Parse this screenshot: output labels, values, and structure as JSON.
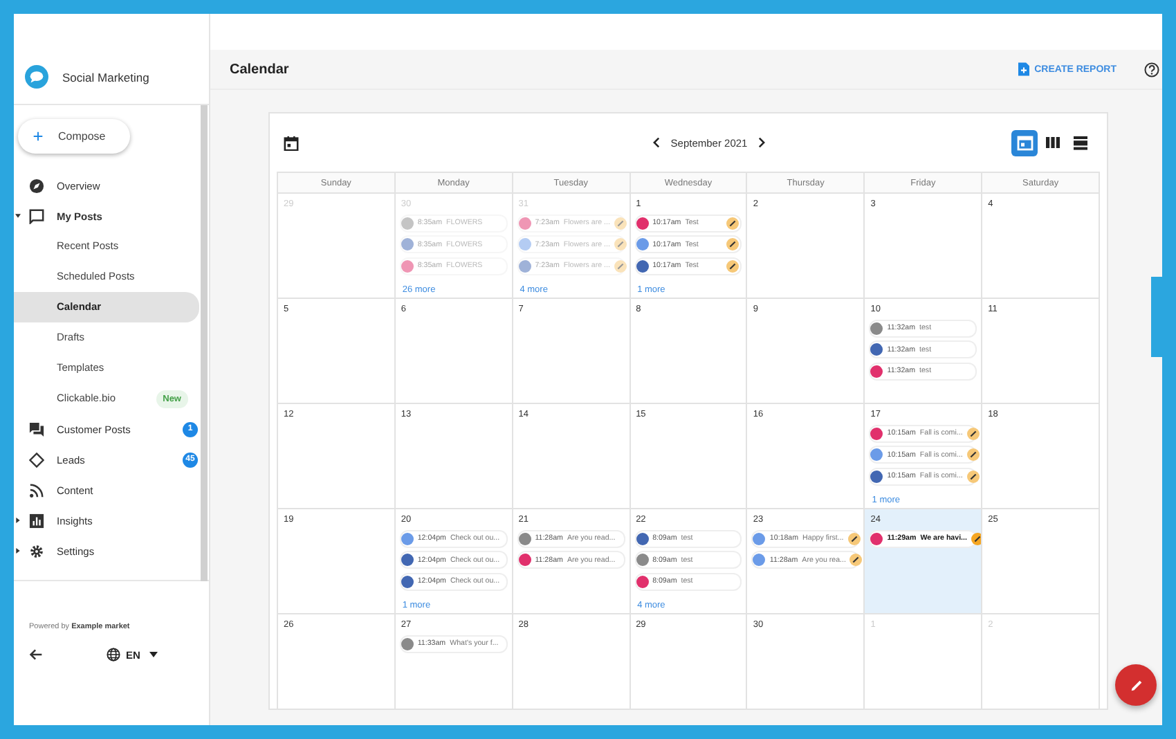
{
  "app": {
    "name": "Social Marketing"
  },
  "compose": {
    "label": "Compose"
  },
  "sidebar": {
    "items": [
      {
        "label": "Overview"
      },
      {
        "label": "My Posts",
        "expanded": true,
        "children": [
          {
            "label": "Recent Posts",
            "selected": false
          },
          {
            "label": "Scheduled Posts",
            "selected": false
          },
          {
            "label": "Calendar",
            "selected": true
          },
          {
            "label": "Drafts",
            "selected": false
          },
          {
            "label": "Templates",
            "selected": false
          },
          {
            "label": "Clickable.bio",
            "selected": false,
            "badge": "New",
            "kind": "new"
          }
        ]
      },
      {
        "label": "Customer Posts",
        "badge": "1",
        "kind": "count"
      },
      {
        "label": "Leads",
        "badge": "45",
        "kind": "count"
      },
      {
        "label": "Content"
      },
      {
        "label": "Insights",
        "expanded": false
      },
      {
        "label": "Settings",
        "expanded": false
      }
    ]
  },
  "footer": {
    "powered_by": "Powered by **Example market**",
    "language": "EN"
  },
  "header": {
    "title": "Calendar",
    "action": "CREATE REPORT"
  },
  "calendar": {
    "month": "September 2021",
    "views": [
      {
        "selected": true
      },
      {
        "selected": false
      },
      {
        "selected": false
      }
    ],
    "weekdays": [
      "Sunday",
      "Monday",
      "Tuesday",
      "Wednesday",
      "Thursday",
      "Friday",
      "Saturday"
    ],
    "weeks": [
      [
        {
          "date": "29",
          "in_month": false,
          "today": false
        },
        {
          "date": "30",
          "in_month": false,
          "today": false,
          "more": "26 more",
          "posts": [
            {
              "kind": "generic",
              "time": "8:35am",
              "text": "FLOWERS",
              "editable": false
            },
            {
              "kind": "facebook",
              "time": "8:35am",
              "text": "FLOWERS",
              "editable": false
            },
            {
              "kind": "instagram",
              "time": "8:35am",
              "text": "FLOWERS",
              "editable": false
            }
          ]
        },
        {
          "date": "31",
          "in_month": false,
          "today": false,
          "more": "4 more",
          "posts": [
            {
              "kind": "instagram",
              "time": "7:23am",
              "text": "Flowers are ...",
              "editable": true
            },
            {
              "kind": "business",
              "time": "7:23am",
              "text": "Flowers are ...",
              "editable": true
            },
            {
              "kind": "facebook",
              "time": "7:23am",
              "text": "Flowers are ...",
              "editable": true
            }
          ]
        },
        {
          "date": "1",
          "in_month": true,
          "today": false,
          "more": "1 more",
          "posts": [
            {
              "kind": "instagram",
              "time": "10:17am",
              "text": "Test",
              "editable": true
            },
            {
              "kind": "business",
              "time": "10:17am",
              "text": "Test",
              "editable": true
            },
            {
              "kind": "facebook",
              "time": "10:17am",
              "text": "Test",
              "editable": true
            }
          ]
        },
        {
          "date": "2",
          "in_month": true,
          "today": false
        },
        {
          "date": "3",
          "in_month": true,
          "today": false
        },
        {
          "date": "4",
          "in_month": true,
          "today": false
        }
      ],
      [
        {
          "date": "5",
          "in_month": true,
          "today": false
        },
        {
          "date": "6",
          "in_month": true,
          "today": false
        },
        {
          "date": "7",
          "in_month": true,
          "today": false
        },
        {
          "date": "8",
          "in_month": true,
          "today": false
        },
        {
          "date": "9",
          "in_month": true,
          "today": false
        },
        {
          "date": "10",
          "in_month": true,
          "today": false,
          "posts": [
            {
              "kind": "generic",
              "time": "11:32am",
              "text": "test",
              "editable": false
            },
            {
              "kind": "facebook",
              "time": "11:32am",
              "text": "test",
              "editable": false
            },
            {
              "kind": "instagram",
              "time": "11:32am",
              "text": "test",
              "editable": false
            }
          ]
        },
        {
          "date": "11",
          "in_month": true,
          "today": false
        }
      ],
      [
        {
          "date": "12",
          "in_month": true,
          "today": false
        },
        {
          "date": "13",
          "in_month": true,
          "today": false
        },
        {
          "date": "14",
          "in_month": true,
          "today": false
        },
        {
          "date": "15",
          "in_month": true,
          "today": false
        },
        {
          "date": "16",
          "in_month": true,
          "today": false
        },
        {
          "date": "17",
          "in_month": true,
          "today": false,
          "more": "1 more",
          "posts": [
            {
              "kind": "instagram",
              "time": "10:15am",
              "text": "Fall is comi...",
              "editable": true
            },
            {
              "kind": "business",
              "time": "10:15am",
              "text": "Fall is comi...",
              "editable": true
            },
            {
              "kind": "facebook",
              "time": "10:15am",
              "text": "Fall is comi...",
              "editable": true
            }
          ]
        },
        {
          "date": "18",
          "in_month": true,
          "today": false
        }
      ],
      [
        {
          "date": "19",
          "in_month": true,
          "today": false
        },
        {
          "date": "20",
          "in_month": true,
          "today": false,
          "more": "1 more",
          "posts": [
            {
              "kind": "business",
              "time": "12:04pm",
              "text": "Check out ou...",
              "editable": false
            },
            {
              "kind": "facebook",
              "time": "12:04pm",
              "text": "Check out ou...",
              "editable": false
            },
            {
              "kind": "facebook",
              "time": "12:04pm",
              "text": "Check out ou...",
              "editable": false
            }
          ]
        },
        {
          "date": "21",
          "in_month": true,
          "today": false,
          "posts": [
            {
              "kind": "generic",
              "time": "11:28am",
              "text": "Are you read...",
              "editable": false
            },
            {
              "kind": "instagram",
              "time": "11:28am",
              "text": "Are you read...",
              "editable": false
            }
          ]
        },
        {
          "date": "22",
          "in_month": true,
          "today": false,
          "more": "4 more",
          "posts": [
            {
              "kind": "facebook",
              "time": "8:09am",
              "text": "test",
              "editable": false
            },
            {
              "kind": "generic",
              "time": "8:09am",
              "text": "test",
              "editable": false
            },
            {
              "kind": "instagram",
              "time": "8:09am",
              "text": "test",
              "editable": false
            }
          ]
        },
        {
          "date": "23",
          "in_month": true,
          "today": false,
          "posts": [
            {
              "kind": "business",
              "time": "10:18am",
              "text": "Happy first...",
              "editable": true
            },
            {
              "kind": "business",
              "time": "11:28am",
              "text": "Are you rea...",
              "editable": true
            }
          ]
        },
        {
          "date": "24",
          "in_month": true,
          "today": true,
          "posts": [
            {
              "kind": "instagram",
              "time": "11:29am",
              "text": "We are havi...",
              "editable": true
            }
          ]
        },
        {
          "date": "25",
          "in_month": true,
          "today": false
        }
      ],
      [
        {
          "date": "26",
          "in_month": true,
          "today": false
        },
        {
          "date": "27",
          "in_month": true,
          "today": false,
          "posts": [
            {
              "kind": "generic",
              "time": "11:33am",
              "text": "What's your f...",
              "editable": false
            }
          ]
        },
        {
          "date": "28",
          "in_month": true,
          "today": false
        },
        {
          "date": "29",
          "in_month": true,
          "today": false
        },
        {
          "date": "30",
          "in_month": true,
          "today": false
        },
        {
          "date": "1",
          "in_month": false,
          "today": false
        },
        {
          "date": "2",
          "in_month": false,
          "today": false
        }
      ]
    ]
  }
}
